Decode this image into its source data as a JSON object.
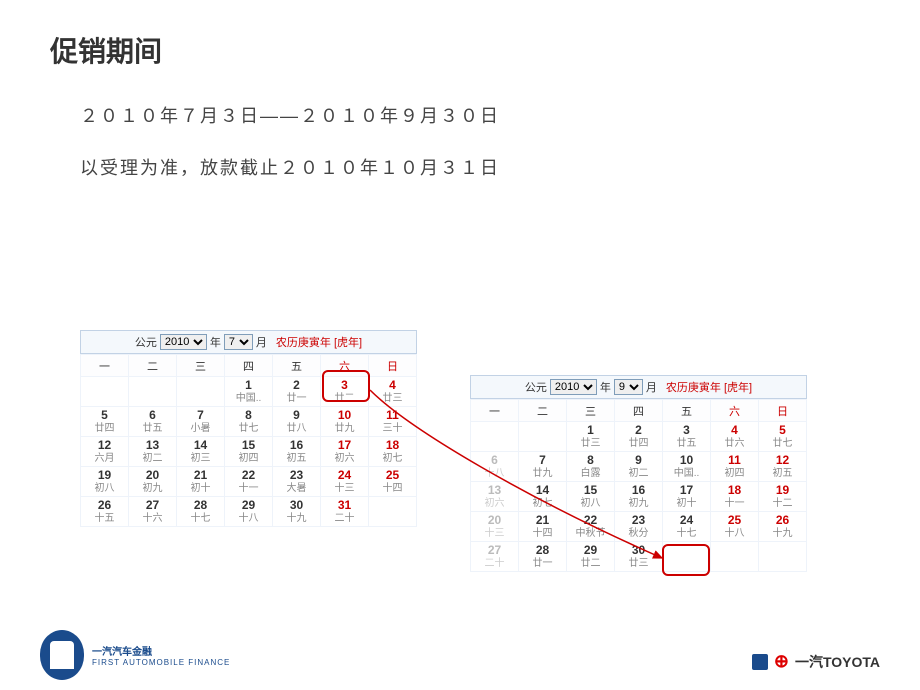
{
  "title": "促销期间",
  "line1": "２０１０年７月３日——２０１０年９月３０日",
  "line2": "以受理为准，放款截止２０１０年１０月３１日",
  "calA": {
    "gongyuan": "公元",
    "year": "2010",
    "yearLabel": "年",
    "month": "7",
    "monthLabel": "月",
    "lunarYear": "农历庚寅年 [虎年]",
    "dow": [
      "一",
      "二",
      "三",
      "四",
      "五",
      "六",
      "日"
    ],
    "rows": [
      [
        [
          "",
          "",
          ""
        ],
        [
          "",
          "",
          ""
        ],
        [
          "",
          "",
          ""
        ],
        [
          "1",
          "中国..",
          0
        ],
        [
          "2",
          "廿一",
          0
        ],
        [
          "3",
          "廿二",
          1
        ],
        [
          "4",
          "廿三",
          1
        ]
      ],
      [
        [
          "5",
          "廿四",
          0
        ],
        [
          "6",
          "廿五",
          0
        ],
        [
          "7",
          "小暑",
          0
        ],
        [
          "8",
          "廿七",
          0
        ],
        [
          "9",
          "廿八",
          0
        ],
        [
          "10",
          "廿九",
          1
        ],
        [
          "11",
          "三十",
          1
        ]
      ],
      [
        [
          "12",
          "六月",
          0
        ],
        [
          "13",
          "初二",
          0
        ],
        [
          "14",
          "初三",
          0
        ],
        [
          "15",
          "初四",
          0
        ],
        [
          "16",
          "初五",
          0
        ],
        [
          "17",
          "初六",
          1
        ],
        [
          "18",
          "初七",
          1
        ]
      ],
      [
        [
          "19",
          "初八",
          0
        ],
        [
          "20",
          "初九",
          0
        ],
        [
          "21",
          "初十",
          0
        ],
        [
          "22",
          "十一",
          0
        ],
        [
          "23",
          "大暑",
          0
        ],
        [
          "24",
          "十三",
          1
        ],
        [
          "25",
          "十四",
          1
        ]
      ],
      [
        [
          "26",
          "十五",
          0
        ],
        [
          "27",
          "十六",
          0
        ],
        [
          "28",
          "十七",
          0
        ],
        [
          "29",
          "十八",
          0
        ],
        [
          "30",
          "十九",
          0
        ],
        [
          "31",
          "二十",
          1
        ],
        [
          "",
          "",
          ""
        ]
      ]
    ]
  },
  "calB": {
    "gongyuan": "公元",
    "year": "2010",
    "yearLabel": "年",
    "month": "9",
    "monthLabel": "月",
    "lunarYear": "农历庚寅年 [虎年]",
    "dow": [
      "一",
      "二",
      "三",
      "四",
      "五",
      "六",
      "日"
    ],
    "rows": [
      [
        [
          "",
          "",
          ""
        ],
        [
          "",
          "",
          ""
        ],
        [
          "1",
          "廿三",
          0
        ],
        [
          "2",
          "廿四",
          0
        ],
        [
          "3",
          "廿五",
          0
        ],
        [
          "4",
          "廿六",
          1
        ],
        [
          "5",
          "廿七",
          1
        ]
      ],
      [
        [
          "6",
          "十八",
          2
        ],
        [
          "7",
          "廿九",
          0
        ],
        [
          "8",
          "白露",
          0
        ],
        [
          "9",
          "初二",
          0
        ],
        [
          "10",
          "中国..",
          0
        ],
        [
          "11",
          "初四",
          1
        ],
        [
          "12",
          "初五",
          1
        ]
      ],
      [
        [
          "13",
          "初六",
          2
        ],
        [
          "14",
          "初七",
          0
        ],
        [
          "15",
          "初八",
          0
        ],
        [
          "16",
          "初九",
          0
        ],
        [
          "17",
          "初十",
          0
        ],
        [
          "18",
          "十一",
          1
        ],
        [
          "19",
          "十二",
          1
        ]
      ],
      [
        [
          "20",
          "十三",
          2
        ],
        [
          "21",
          "十四",
          0
        ],
        [
          "22",
          "中秋节",
          0
        ],
        [
          "23",
          "秋分",
          0
        ],
        [
          "24",
          "十七",
          0
        ],
        [
          "25",
          "十八",
          1
        ],
        [
          "26",
          "十九",
          1
        ]
      ],
      [
        [
          "27",
          "二十",
          2
        ],
        [
          "28",
          "廿一",
          0
        ],
        [
          "29",
          "廿二",
          0
        ],
        [
          "30",
          "廿三",
          0
        ],
        [
          "",
          "",
          ""
        ],
        [
          "",
          "",
          ""
        ],
        [
          "",
          "",
          ""
        ]
      ]
    ]
  },
  "footerLeftName": "一汽汽车金融",
  "footerLeftSub": "FIRST AUTOMOBILE FINANCE",
  "footerRight": "一汽TOYOTA"
}
